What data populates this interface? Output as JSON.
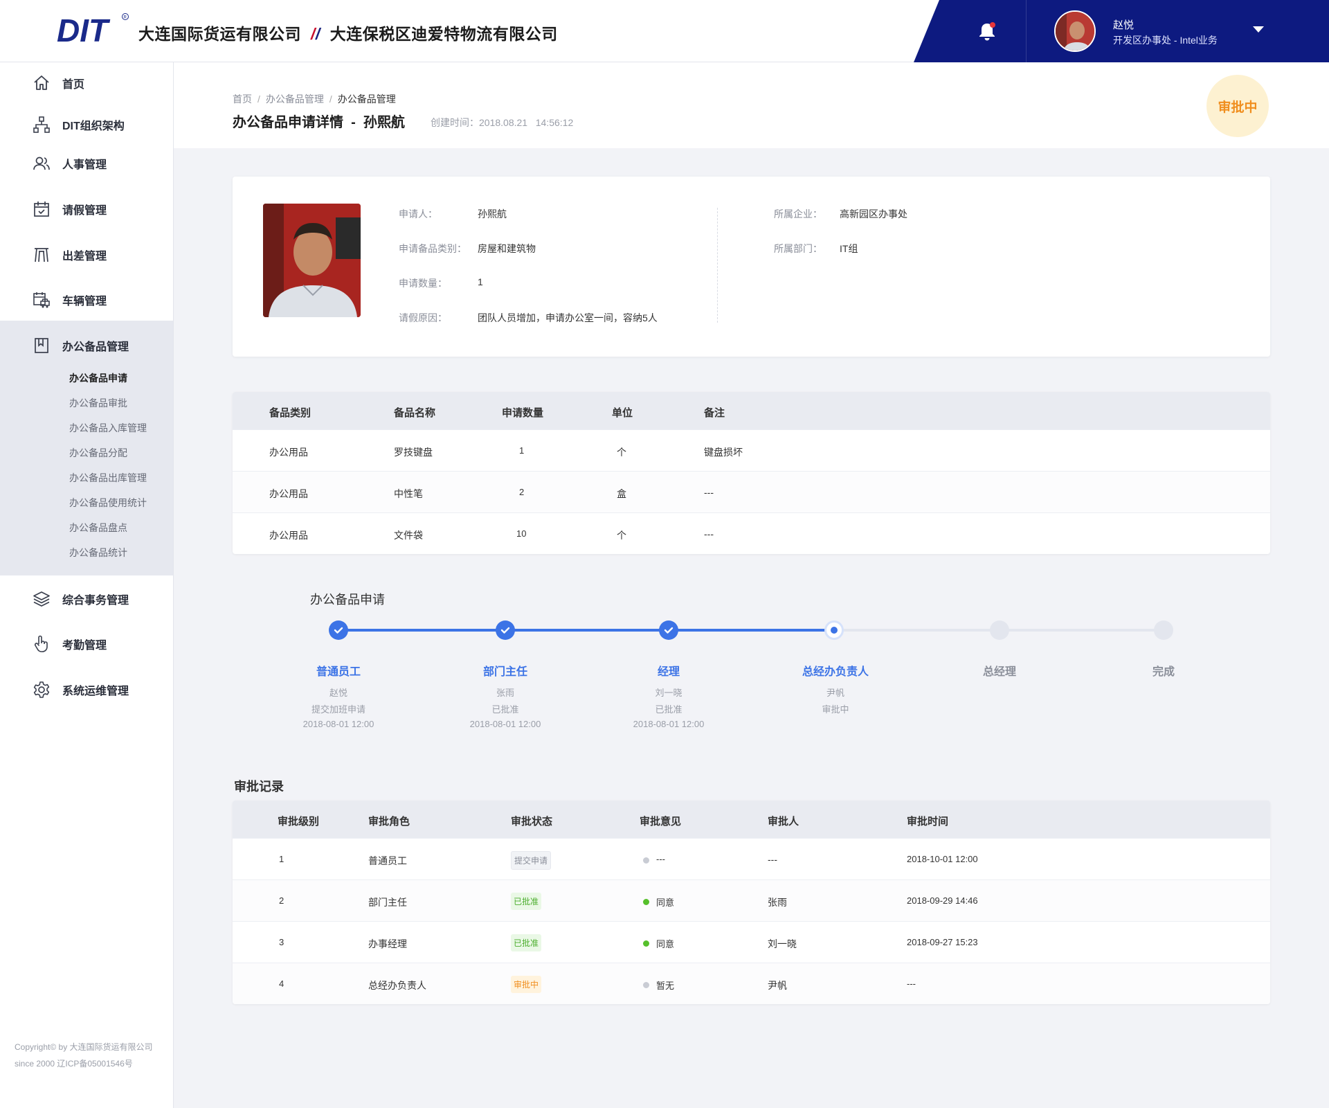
{
  "header": {
    "logo_text": "DIT",
    "company_a": "大连国际货运有限公司",
    "company_b": "大连保税区迪爱特物流有限公司",
    "user_name": "赵悦",
    "user_dept": "开发区办事处 - Intel业务"
  },
  "sidebar": {
    "items": [
      {
        "label": "首页",
        "icon": "home-icon"
      },
      {
        "label": "DIT组织架构",
        "icon": "org-chart-icon"
      },
      {
        "label": "人事管理",
        "icon": "users-icon"
      },
      {
        "label": "请假管理",
        "icon": "calendar-icon"
      },
      {
        "label": "出差管理",
        "icon": "gate-icon"
      },
      {
        "label": "车辆管理",
        "icon": "vehicle-icon"
      },
      {
        "label": "办公备品管理",
        "icon": "bookmark-icon"
      },
      {
        "label": "综合事务管理",
        "icon": "layers-icon"
      },
      {
        "label": "考勤管理",
        "icon": "hand-pointer-icon"
      },
      {
        "label": "系统运维管理",
        "icon": "gear-icon"
      }
    ],
    "sub_items": [
      "办公备品申请",
      "办公备品审批",
      "办公备品入库管理",
      "办公备品分配",
      "办公备品出库管理",
      "办公备品使用统计",
      "办公备品盘点",
      "办公备品统计"
    ],
    "copyright_1": "Copyright© by 大连国际货运有限公司",
    "copyright_2": "since 2000 辽ICP备05001546号"
  },
  "page": {
    "breadcrumb": [
      "首页",
      "办公备品管理",
      "办公备品管理"
    ],
    "title": "办公备品申请详情  -  孙熙航",
    "created": "创建时间：2018.08.21   14:56:12",
    "status": "审批中"
  },
  "info": {
    "applicant_label": "申请人：",
    "applicant": "孙熙航",
    "category_label": "申请备品类别：",
    "category": "房屋和建筑物",
    "qty_label": "申请数量：",
    "qty": "1",
    "reason_label": "请假原因：",
    "reason": "团队人员增加，申请办公室一间，容纳5人",
    "company_label": "所属企业：",
    "company": "高新园区办事处",
    "dept_label": "所属部门：",
    "dept": "IT组"
  },
  "items_table": {
    "headers": [
      "备品类别",
      "备品名称",
      "申请数量",
      "单位",
      "备注"
    ],
    "rows": [
      [
        "办公用品",
        "罗技键盘",
        "1",
        "个",
        "键盘损坏"
      ],
      [
        "办公用品",
        "中性笔",
        "2",
        "盒",
        "---"
      ],
      [
        "办公用品",
        "文件袋",
        "10",
        "个",
        "---"
      ]
    ]
  },
  "steps": {
    "title": "办公备品申请",
    "list": [
      {
        "name": "普通员工",
        "person": "赵悦",
        "action": "提交加班申请",
        "time": "2018-08-01 12:00",
        "state": "done"
      },
      {
        "name": "部门主任",
        "person": "张雨",
        "action": "已批准",
        "time": "2018-08-01 12:00",
        "state": "done"
      },
      {
        "name": "经理",
        "person": "刘一晓",
        "action": "已批准",
        "time": "2018-08-01 12:00",
        "state": "done"
      },
      {
        "name": "总经办负责人",
        "person": "尹帆",
        "action": "审批中",
        "time": "",
        "state": "current"
      },
      {
        "name": "总经理",
        "person": "",
        "action": "",
        "time": "",
        "state": "todo"
      },
      {
        "name": "完成",
        "person": "",
        "action": "",
        "time": "",
        "state": "todo"
      }
    ]
  },
  "records": {
    "title": "审批记录",
    "headers": [
      "审批级别",
      "审批角色",
      "审批状态",
      "审批意见",
      "审批人",
      "审批时间"
    ],
    "rows": [
      {
        "level": "1",
        "role": "普通员工",
        "status": "提交申请",
        "status_color": "grey",
        "opinion": "---",
        "opinion_color": "grey",
        "approver": "---",
        "time": "2018-10-01 12:00"
      },
      {
        "level": "2",
        "role": "部门主任",
        "status": "已批准",
        "status_color": "green",
        "opinion": "同意",
        "opinion_color": "green",
        "approver": "张雨",
        "time": "2018-09-29 14:46"
      },
      {
        "level": "3",
        "role": "办事经理",
        "status": "已批准",
        "status_color": "green",
        "opinion": "同意",
        "opinion_color": "green",
        "approver": "刘一晓",
        "time": "2018-09-27 15:23"
      },
      {
        "level": "4",
        "role": "总经办负责人",
        "status": "审批中",
        "status_color": "orange",
        "opinion": "暂无",
        "opinion_color": "grey",
        "approver": "尹帆",
        "time": "---"
      }
    ]
  },
  "colors": {
    "primary": "#3c73e6",
    "header_dark": "#0d1a80",
    "warn": "#f08e1e",
    "success": "#4cae2e"
  }
}
